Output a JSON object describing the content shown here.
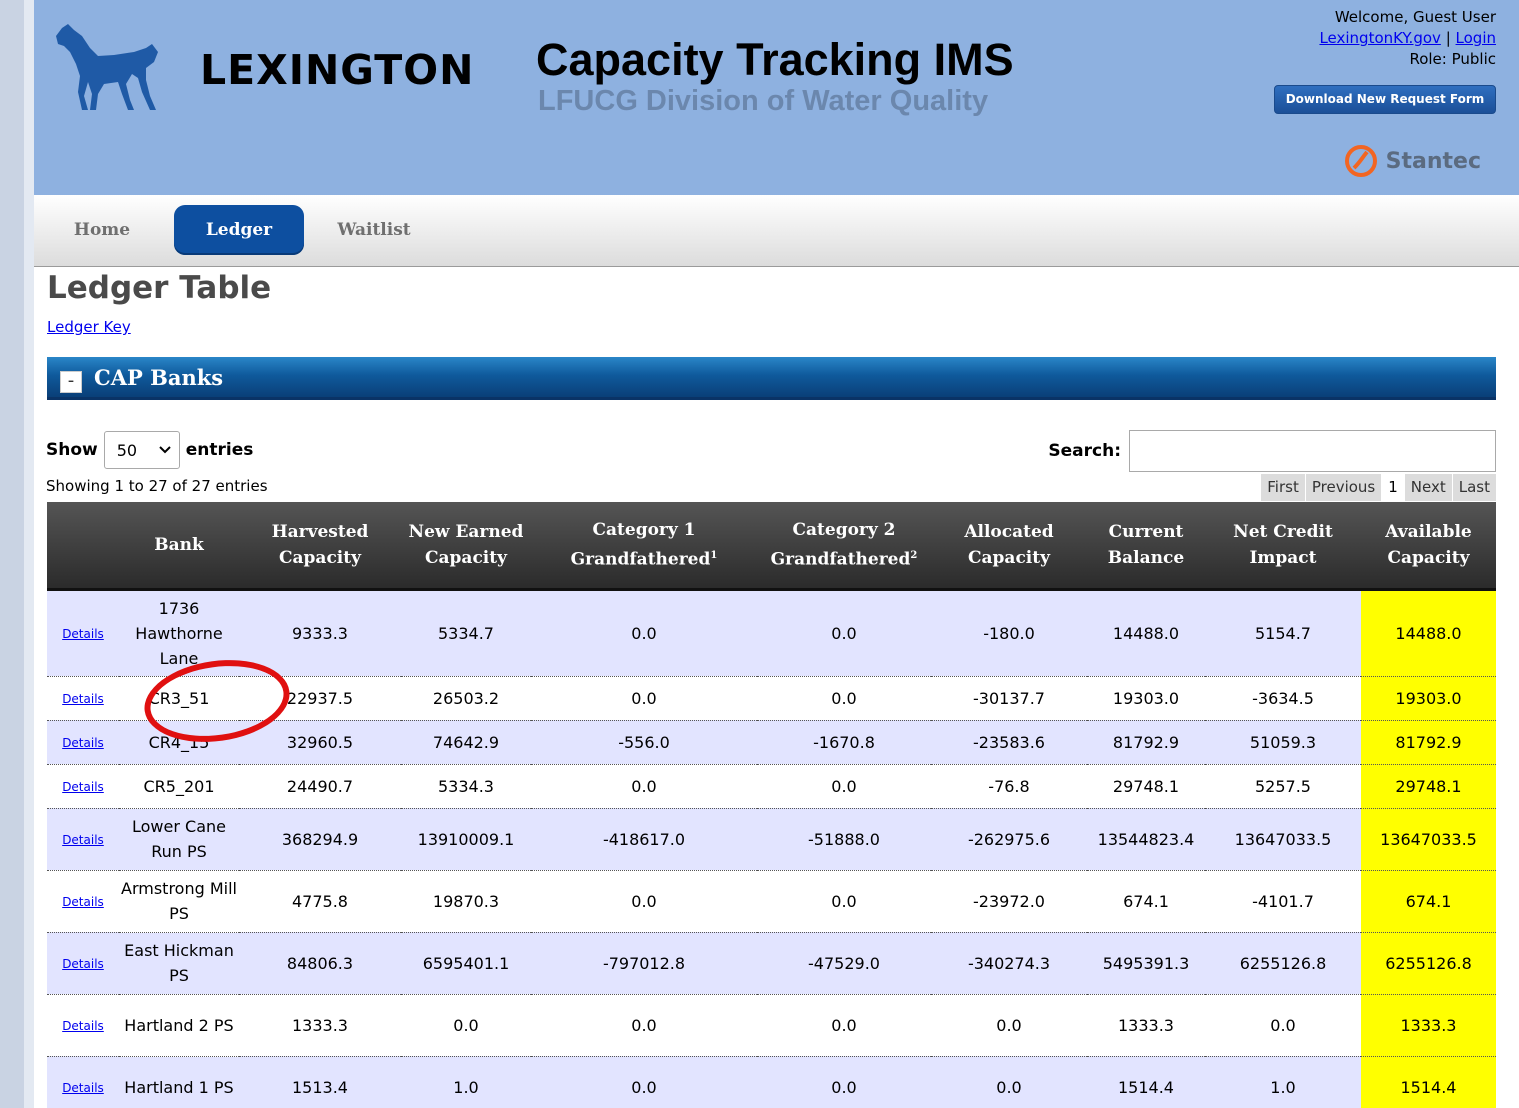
{
  "header": {
    "brand": "LEXINGTON",
    "app_title": "Capacity Tracking IMS",
    "app_subtitle": "LFUCG Division of Water Quality",
    "welcome": "Welcome, Guest User",
    "site_link": "LexingtonKY.gov",
    "separator": "|",
    "login_link": "Login",
    "role": "Role: Public",
    "download_button": "Download New Request Form",
    "partner": "Stantec",
    "horse_icon_color": "#1f5aa6",
    "header_bg": "#8eb1e0"
  },
  "nav": {
    "tabs": [
      {
        "label": "Home",
        "active": false
      },
      {
        "label": "Ledger",
        "active": true
      },
      {
        "label": "Waitlist",
        "active": false
      }
    ]
  },
  "page": {
    "title": "Ledger Table",
    "key_link": "Ledger Key"
  },
  "panel": {
    "collapse_symbol": "-",
    "title": "CAP Banks"
  },
  "controls": {
    "show_label": "Show",
    "entries_value": "50",
    "entries_label": "entries",
    "search_label": "Search:",
    "search_value": "",
    "info": "Showing 1 to 27 of 27 entries",
    "pager": [
      "First",
      "Previous",
      "1",
      "Next",
      "Last"
    ],
    "current_page": "1"
  },
  "table": {
    "columns": [
      "",
      "Bank",
      "Harvested Capacity",
      "New Earned Capacity",
      "Category 1 Grandfathered",
      "Category 2 Grandfathered",
      "Allocated Capacity",
      "Current Balance",
      "Net Credit Impact",
      "Available Capacity"
    ],
    "footnotes": {
      "cat1": "1",
      "cat2": "2"
    },
    "details_label": "Details",
    "highlight_color": "#ffff00",
    "rows": [
      {
        "bank": "1736 Hawthorne Lane",
        "harvested": "9333.3",
        "new_earned": "5334.7",
        "cat1": "0.0",
        "cat2": "0.0",
        "allocated": "-180.0",
        "balance": "14488.0",
        "net": "5154.7",
        "available": "14488.0"
      },
      {
        "bank": "CR3_51",
        "harvested": "22937.5",
        "new_earned": "26503.2",
        "cat1": "0.0",
        "cat2": "0.0",
        "allocated": "-30137.7",
        "balance": "19303.0",
        "net": "-3634.5",
        "available": "19303.0"
      },
      {
        "bank": "CR4_15",
        "harvested": "32960.5",
        "new_earned": "74642.9",
        "cat1": "-556.0",
        "cat2": "-1670.8",
        "allocated": "-23583.6",
        "balance": "81792.9",
        "net": "51059.3",
        "available": "81792.9"
      },
      {
        "bank": "CR5_201",
        "harvested": "24490.7",
        "new_earned": "5334.3",
        "cat1": "0.0",
        "cat2": "0.0",
        "allocated": "-76.8",
        "balance": "29748.1",
        "net": "5257.5",
        "available": "29748.1"
      },
      {
        "bank": "Lower Cane Run PS",
        "harvested": "368294.9",
        "new_earned": "13910009.1",
        "cat1": "-418617.0",
        "cat2": "-51888.0",
        "allocated": "-262975.6",
        "balance": "13544823.4",
        "net": "13647033.5",
        "available": "13647033.5"
      },
      {
        "bank": "Armstrong Mill PS",
        "harvested": "4775.8",
        "new_earned": "19870.3",
        "cat1": "0.0",
        "cat2": "0.0",
        "allocated": "-23972.0",
        "balance": "674.1",
        "net": "-4101.7",
        "available": "674.1"
      },
      {
        "bank": "East Hickman PS",
        "harvested": "84806.3",
        "new_earned": "6595401.1",
        "cat1": "-797012.8",
        "cat2": "-47529.0",
        "allocated": "-340274.3",
        "balance": "5495391.3",
        "net": "6255126.8",
        "available": "6255126.8"
      },
      {
        "bank": "Hartland 2 PS",
        "harvested": "1333.3",
        "new_earned": "0.0",
        "cat1": "0.0",
        "cat2": "0.0",
        "allocated": "0.0",
        "balance": "1333.3",
        "net": "0.0",
        "available": "1333.3"
      },
      {
        "bank": "Hartland 1 PS",
        "harvested": "1513.4",
        "new_earned": "1.0",
        "cat1": "0.0",
        "cat2": "0.0",
        "allocated": "0.0",
        "balance": "1514.4",
        "net": "1.0",
        "available": "1514.4"
      }
    ]
  },
  "annotation": {
    "circle_color": "#e01010"
  }
}
